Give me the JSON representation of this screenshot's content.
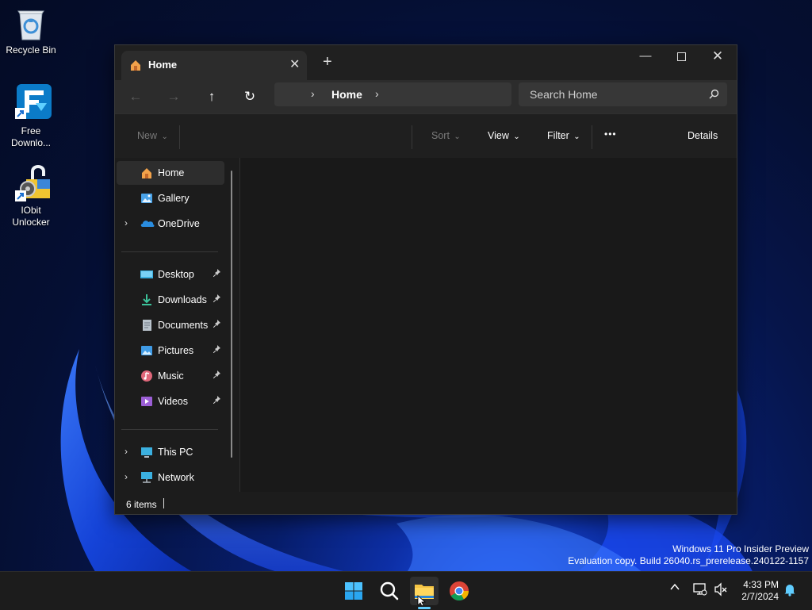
{
  "desktop": {
    "icons": [
      {
        "label": "Recycle Bin"
      },
      {
        "label": "Free Downlo..."
      },
      {
        "label": "IObit Unlocker"
      }
    ],
    "watermark": {
      "line1": "Windows 11 Pro Insider Preview",
      "line2": "Evaluation copy. Build 26040.rs_prerelease.240122-1157"
    }
  },
  "explorer": {
    "tab": {
      "title": "Home",
      "close": "✕"
    },
    "new_tab": "+",
    "window_controls": {
      "minimize": "—",
      "maximize": "☐",
      "close": "✕"
    },
    "nav": {
      "back": "←",
      "forward": "→",
      "up": "↑",
      "refresh": "↻"
    },
    "address": {
      "breadcrumb": "Home",
      "separator": "›"
    },
    "search": {
      "placeholder": "Search Home"
    },
    "toolbar": {
      "new_label": "New",
      "sort_label": "Sort",
      "view_label": "View",
      "filter_label": "Filter",
      "more_label": "•••",
      "details_label": "Details",
      "dropdown_chevron": "⌄"
    },
    "sidebar": {
      "top_items": [
        {
          "label": "Home",
          "icon": "home-icon"
        },
        {
          "label": "Gallery",
          "icon": "gallery-icon"
        },
        {
          "label": "OneDrive",
          "icon": "onedrive-icon",
          "expandable": true
        }
      ],
      "quick_access": [
        {
          "label": "Desktop",
          "icon": "desktop-folder-icon"
        },
        {
          "label": "Downloads",
          "icon": "downloads-icon"
        },
        {
          "label": "Documents",
          "icon": "documents-icon"
        },
        {
          "label": "Pictures",
          "icon": "pictures-icon"
        },
        {
          "label": "Music",
          "icon": "music-icon"
        },
        {
          "label": "Videos",
          "icon": "videos-icon"
        }
      ],
      "bottom_items": [
        {
          "label": "This PC",
          "icon": "this-pc-icon",
          "expandable": true
        },
        {
          "label": "Network",
          "icon": "network-icon",
          "expandable": true
        }
      ],
      "pin_glyph": "📌",
      "expand_glyph": "›"
    },
    "status": {
      "item_count": "6 items"
    }
  },
  "taskbar": {
    "pinned": [
      "start-icon",
      "search-icon",
      "file-explorer-icon",
      "chrome-icon"
    ],
    "tray_chevron": "^",
    "clock": {
      "time": "4:33 PM",
      "date": "2/7/2024"
    }
  },
  "colors": {
    "accent": "#60cdff",
    "window_bg": "#1c1c1c",
    "taskbar_bg": "#1c1c1c"
  }
}
